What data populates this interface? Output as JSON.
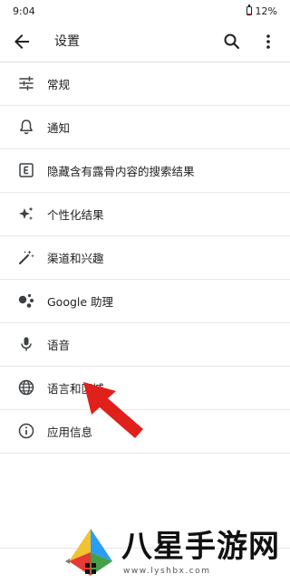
{
  "status": {
    "time": "9:04",
    "battery": "12%",
    "battery_level": 0.12,
    "battery_color": "#d93025"
  },
  "header": {
    "title": "设置"
  },
  "settings_items": [
    {
      "label": "常规",
      "icon": "tune-sliders-icon"
    },
    {
      "label": "通知",
      "icon": "bell-icon"
    },
    {
      "label": "隐藏含有露骨内容的搜索结果",
      "icon": "explicit-filter-icon"
    },
    {
      "label": "个性化结果",
      "icon": "sparkle-icon"
    },
    {
      "label": "渠道和兴趣",
      "icon": "magic-wand-icon"
    },
    {
      "label": "Google 助理",
      "icon": "google-assistant-icon"
    },
    {
      "label": "语音",
      "icon": "microphone-icon"
    },
    {
      "label": "语言和区域",
      "icon": "globe-icon"
    },
    {
      "label": "应用信息",
      "icon": "info-icon"
    }
  ],
  "annotation": {
    "arrow_color": "#e0201b"
  },
  "watermark": {
    "brand": "八星手游网",
    "url": "www.lyshbx.com"
  }
}
